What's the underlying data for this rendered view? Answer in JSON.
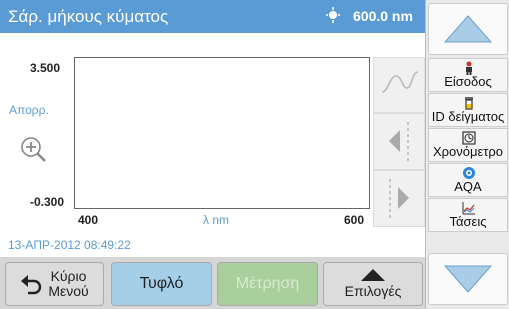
{
  "header": {
    "title": "Σάρ. μήκους κύματος",
    "wavelength": "600.0 nm",
    "lamp_icon": "lamp-icon"
  },
  "chart_data": {
    "type": "line",
    "series": [],
    "ylabel": "Απορρ.",
    "xlabel": "λ nm",
    "xlim": [
      400,
      600
    ],
    "ylim": [
      -0.3,
      3.5
    ],
    "y_ticks": [
      "3.500",
      "-0.300"
    ],
    "x_ticks": [
      "400",
      "600"
    ]
  },
  "main": {
    "timestamp": "13-ΑΠΡ-2012  08:49:22",
    "zoom_icon": "zoom-in-icon"
  },
  "bottom": {
    "home_label": "Κύριο\nΜενού",
    "blank_label": "Τυφλό",
    "measure_label": "Μέτρηση",
    "options_label": "Επιλογές"
  },
  "right": {
    "items": [
      {
        "label": "Είσοδος",
        "icon": "user-icon"
      },
      {
        "label": "ID δείγματος",
        "icon": "sample-vial-icon"
      },
      {
        "label": "Χρονόμετρο",
        "icon": "timer-icon"
      },
      {
        "label": "AQA",
        "icon": "aqa-icon"
      },
      {
        "label": "Τάσεις",
        "icon": "trend-chart-icon"
      }
    ]
  }
}
